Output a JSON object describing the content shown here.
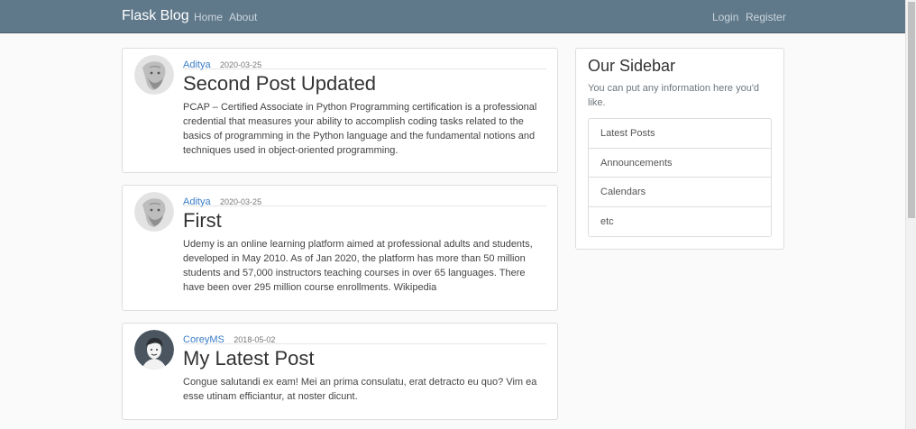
{
  "navbar": {
    "brand": "Flask Blog",
    "links_left": [
      "Home",
      "About"
    ],
    "links_right": [
      "Login",
      "Register"
    ],
    "color": "#5f788a"
  },
  "posts": [
    {
      "author": "Aditya",
      "date": "2020-03-25",
      "title": "Second Post Updated",
      "body": "PCAP – Certified Associate in Python Programming certification is a professional credential that measures your ability to accomplish coding tasks related to the basics of programming in the Python language and the fundamental notions and techniques used in object-oriented programming.",
      "avatar": "bearded-man-avatar"
    },
    {
      "author": "Aditya",
      "date": "2020-03-25",
      "title": "First",
      "body": "Udemy is an online learning platform aimed at professional adults and students, developed in May 2010. As of Jan 2020, the platform has more than 50 million students and 57,000 instructors teaching courses in over 65 languages. There have been over 295 million course enrollments. Wikipedia",
      "avatar": "bearded-man-avatar"
    },
    {
      "author": "CoreyMS",
      "date": "2018-05-02",
      "title": "My Latest Post",
      "body": "Congue salutandi ex eam! Mei an prima consulatu, erat detracto eu quo? Vim ea esse utinam efficiantur, at noster dicunt.",
      "avatar": "cartoon-man-avatar"
    }
  ],
  "sidebar": {
    "title": "Our Sidebar",
    "text": "You can put any information here you'd like.",
    "items": [
      "Latest Posts",
      "Announcements",
      "Calendars",
      "etc"
    ]
  },
  "colors": {
    "link": "#3a7dc9"
  }
}
